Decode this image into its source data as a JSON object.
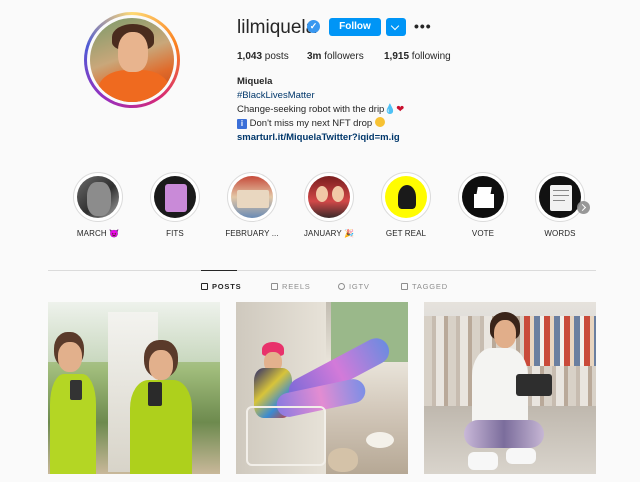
{
  "profile": {
    "username": "lilmiquela",
    "verified_mark": "✓",
    "follow_label": "Follow",
    "more_label": "•••",
    "stats": {
      "posts_count": "1,043",
      "posts_label": " posts",
      "followers_count": "3m",
      "followers_label": " followers",
      "following_count": "1,915",
      "following_label": " following"
    },
    "bio": {
      "name": "Miquela",
      "hashtag": "#BlackLivesMatter",
      "line1": "Change-seeking robot with the drip",
      "line1_emoji_drop": "💧",
      "line1_emoji_heart": "❤",
      "line2_info": "i",
      "line2": " Don't miss my next NFT drop ",
      "link": "smarturl.it/MiquelaTwitter?iqid=m.ig"
    }
  },
  "highlights": [
    {
      "label": "MARCH 😈"
    },
    {
      "label": "FITS"
    },
    {
      "label": "FEBRUARY ..."
    },
    {
      "label": "JANUARY 🎉"
    },
    {
      "label": "GET REAL"
    },
    {
      "label": "VOTE"
    },
    {
      "label": "WORDS"
    }
  ],
  "tabs": [
    {
      "label": "POSTS",
      "icon": "grid-icon",
      "active": true
    },
    {
      "label": "REELS",
      "icon": "reels-icon"
    },
    {
      "label": "IGTV",
      "icon": "igtv-icon"
    },
    {
      "label": "TAGGED",
      "icon": "tagged-icon"
    }
  ],
  "colors": {
    "accent": "#0095f6",
    "link": "#00376b",
    "verified": "#3897f0"
  }
}
